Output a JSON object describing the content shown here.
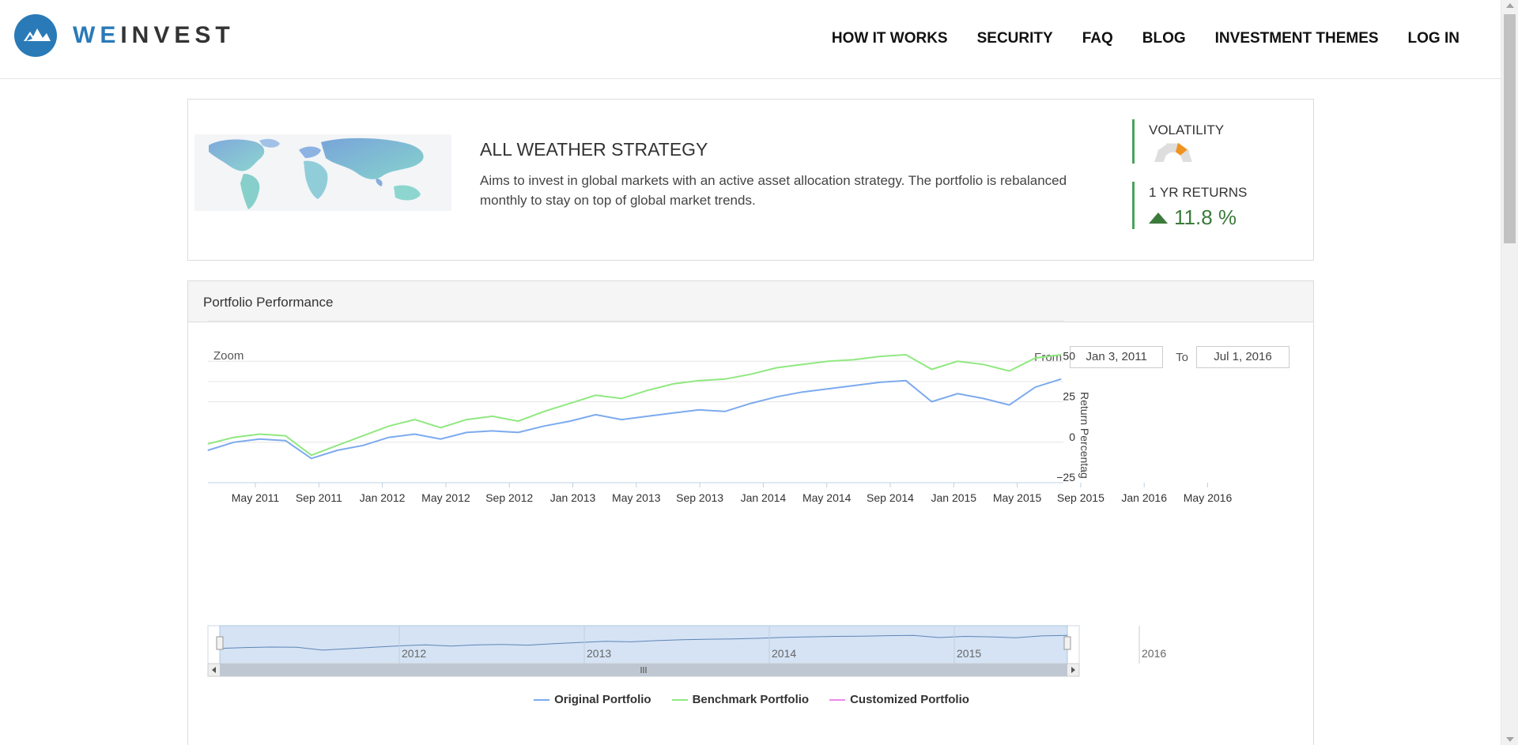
{
  "brand": {
    "we": "WE",
    "invest": "INVEST",
    "accent": "#2a7ab8"
  },
  "nav": [
    {
      "label": "HOW IT WORKS"
    },
    {
      "label": "SECURITY"
    },
    {
      "label": "FAQ"
    },
    {
      "label": "BLOG"
    },
    {
      "label": "INVESTMENT THEMES"
    },
    {
      "label": "LOG IN"
    }
  ],
  "strategy": {
    "title": "ALL WEATHER STRATEGY",
    "description": "Aims to invest in global markets with an active asset allocation strategy. The portfolio is rebalanced monthly to stay on top of global market trends.",
    "volatility_label": "VOLATILITY",
    "volatility_level": 4,
    "volatility_levels_total": 5,
    "returns_label": "1 YR RETURNS",
    "returns_value": "11.8 %"
  },
  "performance": {
    "header": "Portfolio Performance",
    "zoom_label": "Zoom",
    "from_label": "From",
    "from_value": "Jan 3, 2011",
    "to_label": "To",
    "to_value": "Jul 1, 2016"
  },
  "chart_data": {
    "type": "line",
    "y_axis_title": "Return Percentag",
    "y_ticks": [
      50,
      25,
      0,
      -25
    ],
    "ylim": [
      -25,
      75
    ],
    "x_tick_labels": [
      "May 2011",
      "Sep 2011",
      "Jan 2012",
      "May 2012",
      "Sep 2012",
      "Jan 2013",
      "May 2013",
      "Sep 2013",
      "Jan 2014",
      "May 2014",
      "Sep 2014",
      "Jan 2015",
      "May 2015",
      "Sep 2015",
      "Jan 2016",
      "May 2016"
    ],
    "navigator_labels": [
      "2012",
      "2013",
      "2014",
      "2015",
      "2016"
    ],
    "x": [
      "2011-01",
      "2011-03",
      "2011-05",
      "2011-07",
      "2011-09",
      "2011-11",
      "2012-01",
      "2012-03",
      "2012-05",
      "2012-07",
      "2012-09",
      "2012-11",
      "2013-01",
      "2013-03",
      "2013-05",
      "2013-07",
      "2013-09",
      "2013-11",
      "2014-01",
      "2014-03",
      "2014-05",
      "2014-07",
      "2014-09",
      "2014-11",
      "2015-01",
      "2015-03",
      "2015-05",
      "2015-07",
      "2015-09",
      "2015-11",
      "2016-01",
      "2016-03",
      "2016-05",
      "2016-07"
    ],
    "series": [
      {
        "name": "Original Portfolio",
        "color": "#7caaee",
        "values": [
          -5,
          0,
          2,
          1,
          -10,
          -5,
          -2,
          3,
          5,
          2,
          6,
          7,
          6,
          10,
          13,
          17,
          14,
          16,
          18,
          20,
          19,
          24,
          28,
          31,
          33,
          35,
          37,
          38,
          25,
          30,
          27,
          23,
          34,
          39
        ]
      },
      {
        "name": "Benchmark Portfolio",
        "color": "#90e880",
        "values": [
          -1,
          3,
          5,
          4,
          -8,
          -2,
          4,
          10,
          14,
          9,
          14,
          16,
          13,
          19,
          24,
          29,
          27,
          32,
          36,
          38,
          39,
          42,
          46,
          48,
          50,
          51,
          53,
          54,
          45,
          50,
          48,
          44,
          52,
          54
        ]
      },
      {
        "name": "Customized Portfolio",
        "color": "#ee88ee",
        "values": []
      }
    ]
  }
}
